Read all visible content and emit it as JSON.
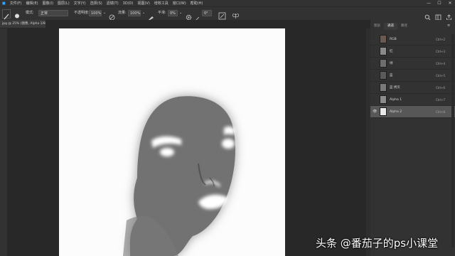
{
  "menu": [
    "文件(F)",
    "编辑(E)",
    "图像(I)",
    "图层(L)",
    "文字(Y)",
    "选择(S)",
    "滤镜(T)",
    "3D(D)",
    "视图(V)",
    "增效工具",
    "窗口(W)",
    "帮助(H)"
  ],
  "window_controls": {
    "minimize": "—",
    "maximize": "☐",
    "close": "✕"
  },
  "options_bar": {
    "mode_label": "模式:",
    "mode_value": "正常",
    "opacity_label": "不透明度:",
    "opacity_value": "100%",
    "flow_label": "流量:",
    "flow_value": "100%",
    "smoothing_label": "平滑:",
    "smoothing_value": "0%",
    "angle_value": "0°"
  },
  "document_tab": "jpg @ 25% (图像, Alpha 1/8) *",
  "panel_tabs": [
    "图层",
    "通道",
    "路径"
  ],
  "channels": [
    {
      "name": "RGB",
      "shortcut": "Ctrl+2",
      "visible": false,
      "selected": false,
      "thumb": "#6a5a52"
    },
    {
      "name": "红",
      "shortcut": "Ctrl+3",
      "visible": false,
      "selected": false,
      "thumb": "#8a8a8a"
    },
    {
      "name": "绿",
      "shortcut": "Ctrl+4",
      "visible": false,
      "selected": false,
      "thumb": "#6e6e6e"
    },
    {
      "name": "蓝",
      "shortcut": "Ctrl+5",
      "visible": false,
      "selected": false,
      "thumb": "#5a5a5a"
    },
    {
      "name": "蓝 拷贝",
      "shortcut": "Ctrl+6",
      "visible": false,
      "selected": false,
      "thumb": "#7a7a7a"
    },
    {
      "name": "Alpha 1",
      "shortcut": "Ctrl+7",
      "visible": false,
      "selected": false,
      "thumb": "#8c8c8c"
    },
    {
      "name": "Alpha 2",
      "shortcut": "Ctrl+8",
      "visible": true,
      "selected": true,
      "thumb": "#e8e8e8"
    }
  ],
  "watermark": "头条 @番茄子的ps小课堂",
  "colors": {
    "accent": "#575757",
    "canvas_bg": "#fcfcfc",
    "ui_bg": "#323232"
  }
}
